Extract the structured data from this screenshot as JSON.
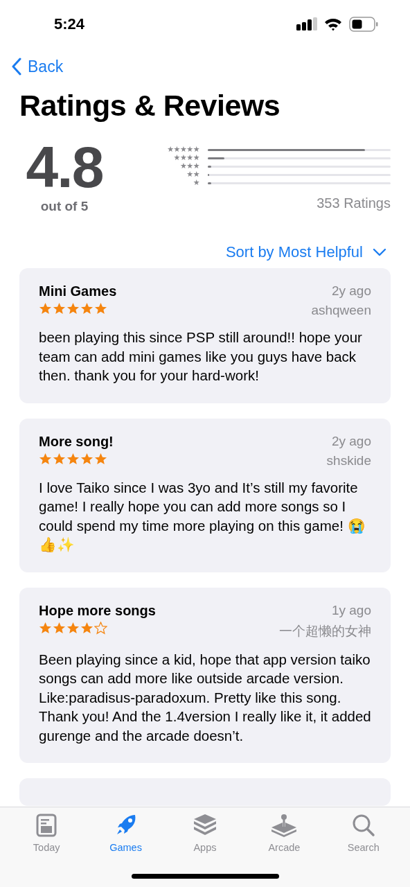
{
  "status_bar": {
    "time": "5:24"
  },
  "nav": {
    "back": "Back"
  },
  "title": "Ratings & Reviews",
  "summary": {
    "score": "4.8",
    "out_of": "out of 5",
    "count": "353 Ratings",
    "histogram": [
      {
        "label": "★★★★★",
        "level": 0.86
      },
      {
        "label": "★★★★",
        "level": 0.09
      },
      {
        "label": "★★★",
        "level": 0.02
      },
      {
        "label": "★★",
        "level": 0.005
      },
      {
        "label": "★",
        "level": 0.02
      }
    ]
  },
  "sort": {
    "label": "Sort by Most Helpful"
  },
  "reviews": [
    {
      "title": "Mini Games",
      "date": "2y ago",
      "author": "ashqween",
      "stars": 5,
      "body": "been playing this since PSP still around!! hope your team can add mini games like you guys have back then. thank you for your hard-work!"
    },
    {
      "title": "More song!",
      "date": "2y ago",
      "author": "shskide",
      "stars": 5,
      "body": "I love Taiko since I was 3yo and It’s still my favorite game! I really hope you can add more songs so I could spend my time more playing on this game! 😭👍✨"
    },
    {
      "title": "Hope more songs",
      "date": "1y ago",
      "author": "一个超懒的女神",
      "stars": 4,
      "body": "Been playing since a kid, hope that app version taiko songs can add more like outside arcade version. Like:paradisus-paradoxum. Pretty like this song. Thank you! And the 1.4version I really like it, it added gurenge and the arcade doesn’t."
    }
  ],
  "tab_bar": [
    {
      "label": "Today",
      "kind": "today",
      "selected": false
    },
    {
      "label": "Games",
      "kind": "games",
      "selected": true
    },
    {
      "label": "Apps",
      "kind": "apps",
      "selected": false
    },
    {
      "label": "Arcade",
      "kind": "arcade",
      "selected": false
    },
    {
      "label": "Search",
      "kind": "search",
      "selected": false
    }
  ]
}
